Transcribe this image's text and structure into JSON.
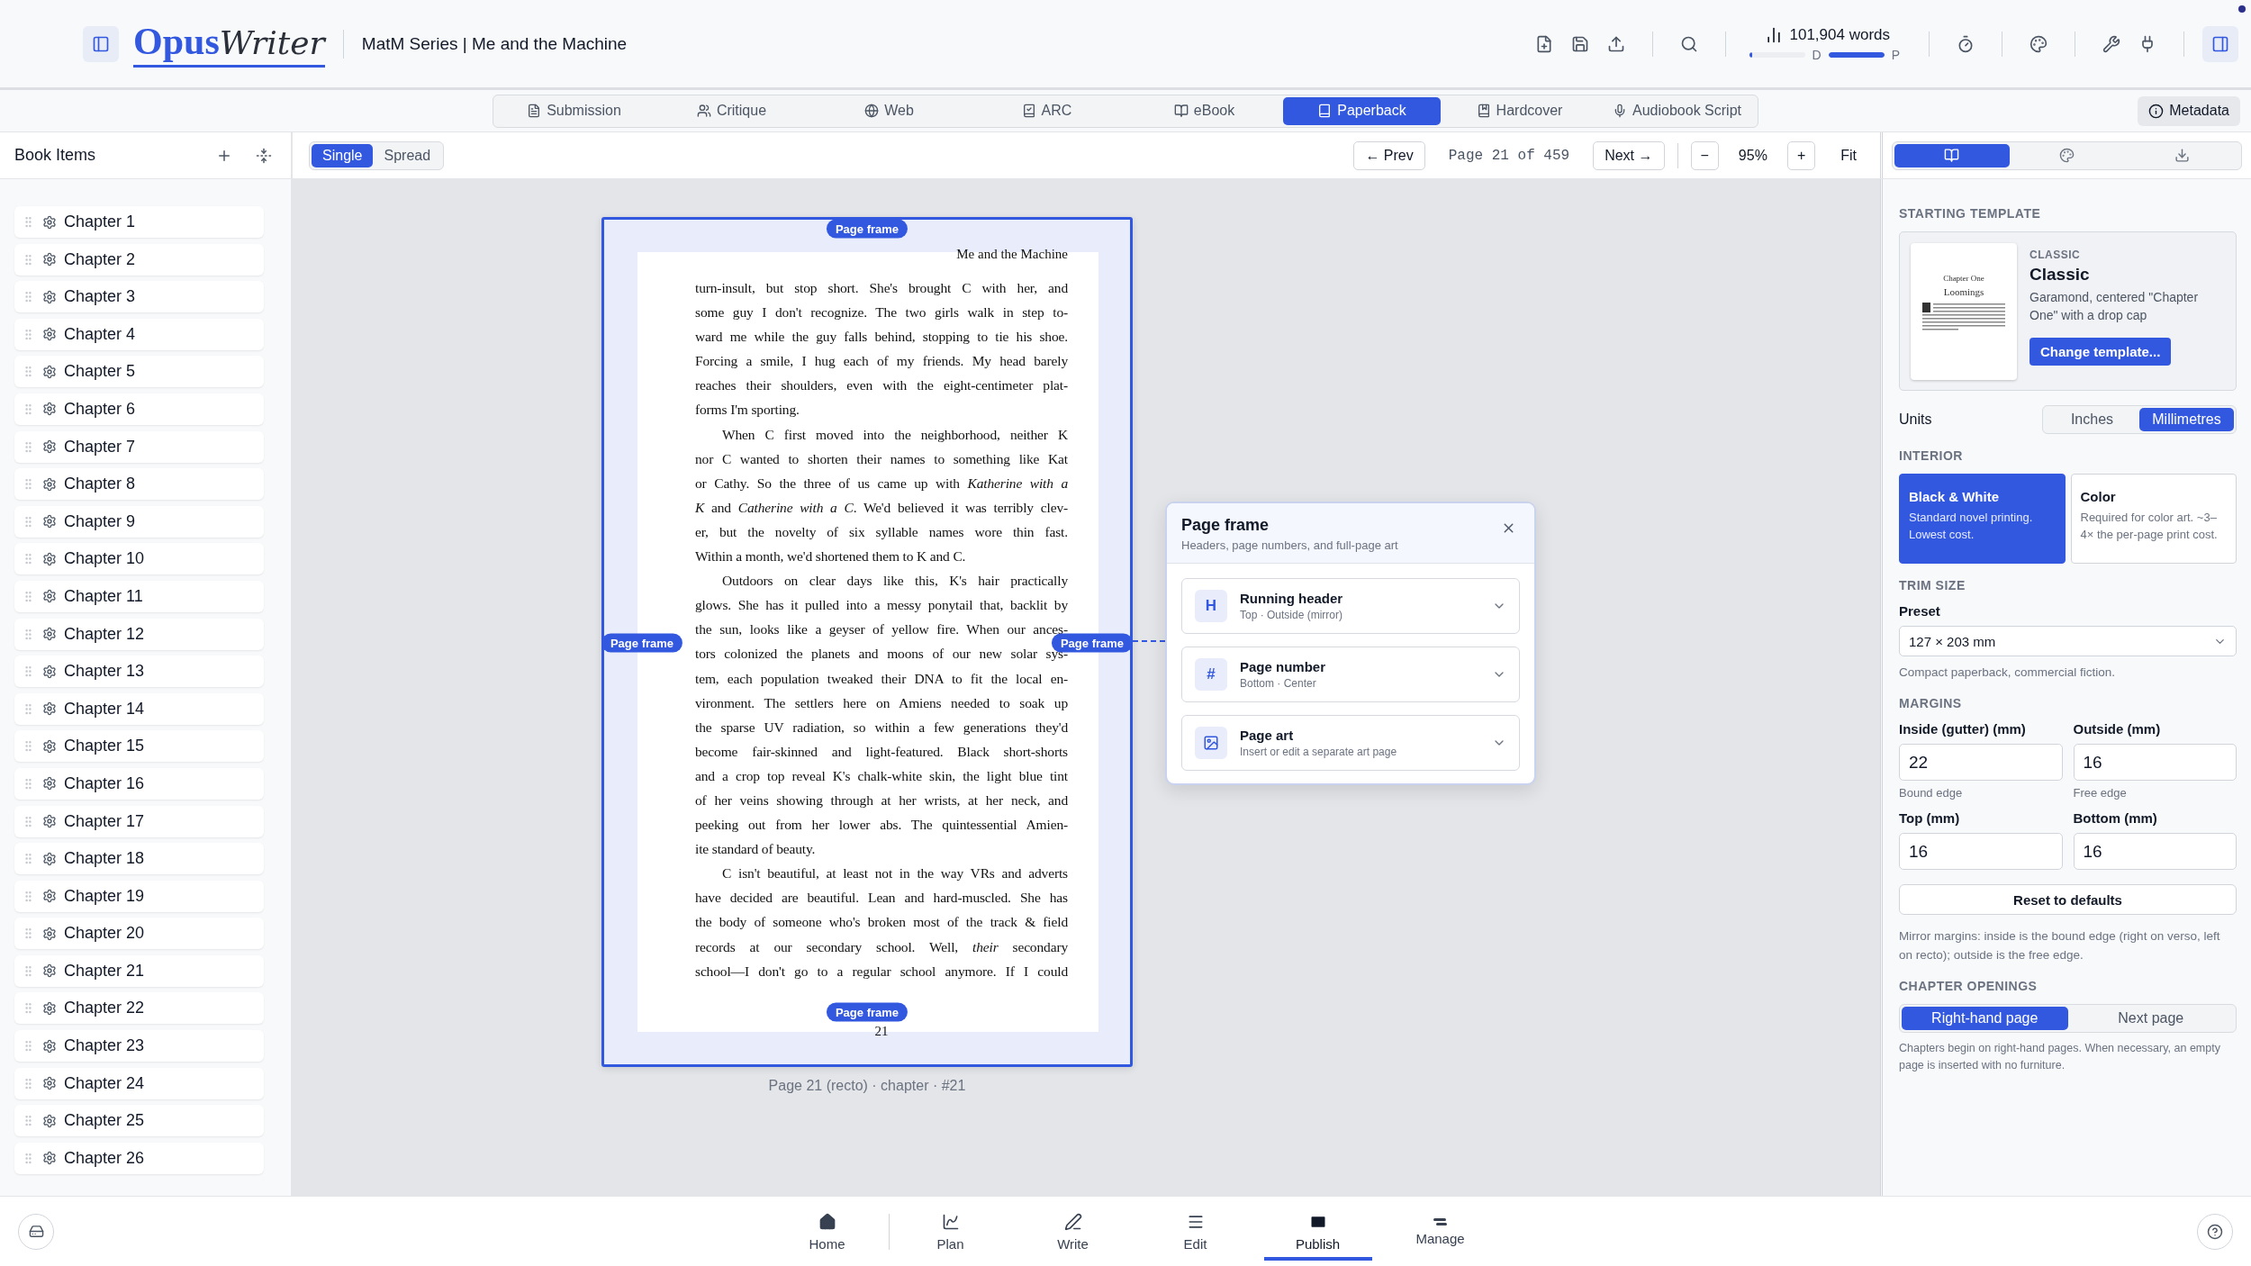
{
  "header": {
    "logo": {
      "first": "Opus",
      "second": "Writer"
    },
    "title": "MatM Series | Me and the Machine",
    "word_count": "101,904 words",
    "progress": [
      {
        "label": "D",
        "level": 0.06
      },
      {
        "label": "P",
        "level": 1
      }
    ]
  },
  "format_tabs": [
    {
      "label": "Submission",
      "selected": false
    },
    {
      "label": "Critique",
      "selected": false
    },
    {
      "label": "Web",
      "selected": false
    },
    {
      "label": "ARC",
      "selected": false
    },
    {
      "label": "eBook",
      "selected": false
    },
    {
      "label": "Paperback",
      "selected": true
    },
    {
      "label": "Hardcover",
      "selected": false
    },
    {
      "label": "Audiobook Script",
      "selected": false
    }
  ],
  "metadata_button": "Metadata",
  "sidebar": {
    "title": "Book Items",
    "items": [
      "Chapter 1",
      "Chapter 2",
      "Chapter 3",
      "Chapter 4",
      "Chapter 5",
      "Chapter 6",
      "Chapter 7",
      "Chapter 8",
      "Chapter 9",
      "Chapter 10",
      "Chapter 11",
      "Chapter 12",
      "Chapter 13",
      "Chapter 14",
      "Chapter 15",
      "Chapter 16",
      "Chapter 17",
      "Chapter 18",
      "Chapter 19",
      "Chapter 20",
      "Chapter 21",
      "Chapter 22",
      "Chapter 23",
      "Chapter 24",
      "Chapter 25",
      "Chapter 26"
    ]
  },
  "toolbar": {
    "view_modes": [
      {
        "label": "Single",
        "selected": true
      },
      {
        "label": "Spread",
        "selected": false
      }
    ],
    "prev": "← Prev",
    "page_indicator": "Page 21 of 459",
    "next": "Next →",
    "zoom_out": "−",
    "zoom": "95%",
    "zoom_in": "+",
    "fit": "Fit"
  },
  "panel_tabs": [
    {
      "selected": true
    },
    {
      "selected": false
    },
    {
      "selected": false
    }
  ],
  "page": {
    "running_header": "Me and the Machine",
    "page_number": "21",
    "frame_badges": [
      "Page frame",
      "Page frame",
      "Page frame",
      "Page frame"
    ],
    "caption": "Page 21 (recto) · chapter · #21",
    "paragraphs": [
      {
        "indent": false,
        "ends": true,
        "lines": [
          "turn-insult, but stop short. She's brought C with her, and",
          "some guy I don't recognize. The two girls walk in step to-",
          "ward me while the guy falls behind, stopping to tie his shoe.",
          "Forcing a smile, I hug each of my friends. My head barely",
          "reaches their shoulders, even with the eight-centimeter plat-",
          "forms I'm sporting."
        ]
      },
      {
        "indent": true,
        "ends": true,
        "lines": [
          "When C first moved into the neighborhood, neither K",
          "nor C wanted to shorten their names to something like Kat",
          "or Cathy. So the three of us came up with *Katherine with a*",
          "*K* and *Catherine with a C*. We'd believed it was terribly clev-",
          "er, but the novelty of six syllable names wore thin fast.",
          "Within a month, we'd shortened them to K and C."
        ]
      },
      {
        "indent": true,
        "ends": true,
        "lines": [
          "Outdoors on clear days like this, K's hair practically",
          "glows. She has it pulled into a messy ponytail that, backlit by",
          "the sun, looks like a geyser of yellow fire. When our ances-",
          "tors colonized the planets and moons of our new solar sys-",
          "tem, each population tweaked their DNA to fit the local en-",
          "vironment. The settlers here on Amiens needed to soak up",
          "the sparse UV radiation, so within a few generations they'd",
          "become fair-skinned and light-featured. Black short-shorts",
          "and a crop top reveal K's chalk-white skin, the light blue tint",
          "of her veins showing through at her wrists, at her neck, and",
          "peeking out from her lower abs. The quintessential Amien-",
          "ite standard of beauty."
        ]
      },
      {
        "indent": true,
        "ends": false,
        "lines": [
          "C isn't beautiful, at least not in the way VRs and adverts",
          "have decided are beautiful. Lean and hard-muscled. She has",
          "the body of someone who's broken most of the track & field",
          "records at our secondary school. Well, *their* secondary",
          "school—I don't go to a regular school anymore. If I could"
        ]
      }
    ]
  },
  "popover": {
    "title": "Page frame",
    "subtitle": "Headers, page numbers, and full-page art",
    "items": [
      {
        "kind": "glyph",
        "glyph": "H",
        "title": "Running header",
        "detail": "Top · Outside (mirror)"
      },
      {
        "kind": "glyph",
        "glyph": "#",
        "title": "Page number",
        "detail": "Bottom · Center"
      },
      {
        "kind": "image",
        "title": "Page art",
        "detail": "Insert or edit a separate art page"
      }
    ]
  },
  "settings": {
    "template_heading": "STARTING TEMPLATE",
    "template": {
      "preview_title": "Chapter One",
      "preview_heading": "Loomings",
      "tag": "CLASSIC",
      "name": "Classic",
      "description": "Garamond, centered \"Chapter One\" with a drop cap",
      "button": "Change template..."
    },
    "units_label": "Units",
    "units": [
      {
        "label": "Inches",
        "selected": false
      },
      {
        "label": "Millimetres",
        "selected": true
      }
    ],
    "interior_heading": "INTERIOR",
    "interior": [
      {
        "title": "Black & White",
        "description": "Standard novel printing. Lowest cost.",
        "selected": true
      },
      {
        "title": "Color",
        "description": "Required for color art. ~3–4× the per-page print cost.",
        "selected": false
      }
    ],
    "trim_heading": "TRIM SIZE",
    "preset_label": "Preset",
    "preset_value": "127 × 203 mm",
    "preset_hint": "Compact paperback, commercial fiction.",
    "margins_heading": "MARGINS",
    "margins": [
      {
        "label": "Inside (gutter) (mm)",
        "value": "22",
        "hint": "Bound edge"
      },
      {
        "label": "Outside (mm)",
        "value": "16",
        "hint": "Free edge"
      },
      {
        "label": "Top (mm)",
        "value": "16"
      },
      {
        "label": "Bottom (mm)",
        "value": "16"
      }
    ],
    "reset_button": "Reset to defaults",
    "mirror_note": "Mirror margins: inside is the bound edge (right on verso, left on recto); outside is the free edge.",
    "openings_heading": "CHAPTER OPENINGS",
    "openings": [
      {
        "label": "Right-hand page",
        "selected": true
      },
      {
        "label": "Next page",
        "selected": false
      }
    ],
    "openings_note": "Chapters begin on right-hand pages. When necessary, an empty page is inserted with no furniture."
  },
  "bottom_nav": [
    {
      "label": "Home",
      "selected": false
    },
    {
      "label": "Plan",
      "selected": false
    },
    {
      "label": "Write",
      "selected": false
    },
    {
      "label": "Edit",
      "selected": false
    },
    {
      "label": "Publish",
      "selected": true
    },
    {
      "label": "Manage",
      "selected": false
    }
  ]
}
